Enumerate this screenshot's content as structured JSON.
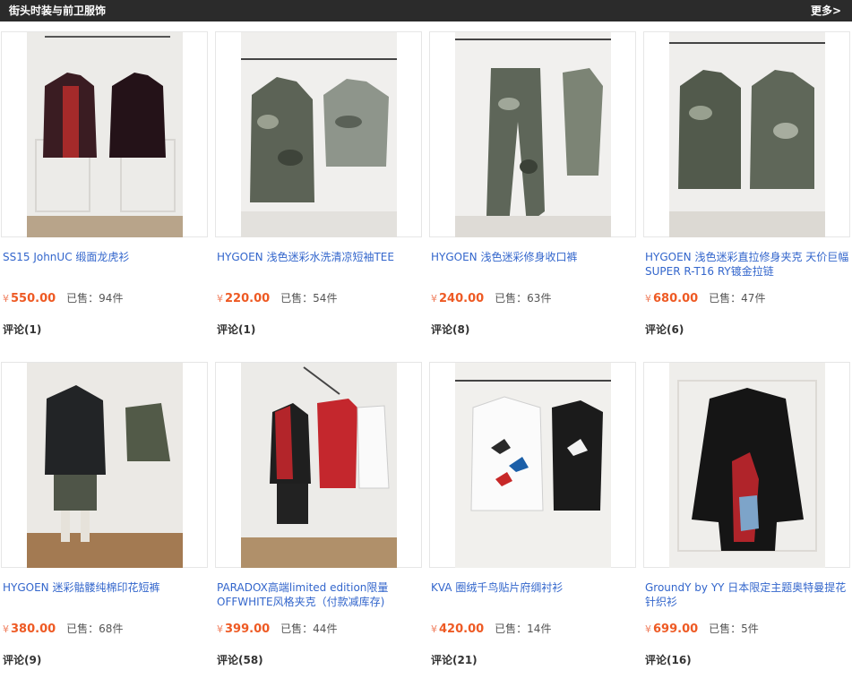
{
  "header": {
    "title": "街头时装与前卫服饰",
    "more_label": "更多>"
  },
  "colors": {
    "link": "#3366cc",
    "price": "#ee5a24",
    "header_bg": "#2b2b2b"
  },
  "products": [
    {
      "name": "SS15 JohnUC 缎面龙虎衫",
      "currency": "¥",
      "price": "550.00",
      "sold": "已售：94件",
      "review": "评论(1)",
      "image": "two embroidered souvenir jackets on hangers"
    },
    {
      "name": "HYGOEN 浅色迷彩水洗清凉短袖TEE",
      "currency": "¥",
      "price": "220.00",
      "sold": "已售：54件",
      "review": "评论(1)",
      "image": "camo jacket and camo t-shirt"
    },
    {
      "name": "HYGOEN 浅色迷彩修身收口裤",
      "currency": "¥",
      "price": "240.00",
      "sold": "已售：63件",
      "review": "评论(8)",
      "image": "camo jogger pants and camo jacket"
    },
    {
      "name": "HYGOEN 浅色迷彩直拉修身夹克 天价巨幅SUPER R-T16 RY镀金拉链",
      "currency": "¥",
      "price": "680.00",
      "sold": "已售：47件",
      "review": "评论(6)",
      "image": "two camo zip jackets"
    },
    {
      "name": "HYGOEN 迷彩骷髅纯棉印花短裤",
      "currency": "¥",
      "price": "380.00",
      "sold": "已售：68件",
      "review": "评论(9)",
      "image": "mannequin in black hoodie and camo shorts"
    },
    {
      "name": "PARADOX高端limited edition限量OFFWHITE风格夹克（付款减库存)",
      "currency": "¥",
      "price": "399.00",
      "sold": "已售：44件",
      "review": "评论(58)",
      "image": "mannequin with red jacket and hanging shirts"
    },
    {
      "name": "KVA 圈绒千鸟贴片府绸衬衫",
      "currency": "¥",
      "price": "420.00",
      "sold": "已售：14件",
      "review": "评论(21)",
      "image": "white and black shirts with bird patches"
    },
    {
      "name": "GroundY by YY 日本限定主题奥特曼提花针织衫",
      "currency": "¥",
      "price": "699.00",
      "sold": "已售：5件",
      "review": "评论(16)",
      "image": "black knit sweater with graphic"
    }
  ]
}
